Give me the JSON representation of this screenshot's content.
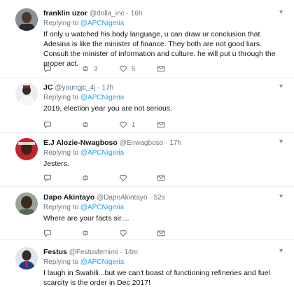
{
  "tweets": [
    {
      "name": "franklin uzor",
      "handle": "@dolla_inc",
      "time": "16h",
      "replying_label": "Replying to",
      "replying_to": "@APCNigeria",
      "text": "If only u watched his body language, u can draw ur conclusion that Adesina  is like the minister of finance.  They both are not good liars. Consult the minister of information and culture. he will put u through the proper act.",
      "reply_count": "",
      "retweet_count": "3",
      "like_count": "5"
    },
    {
      "name": "JC",
      "handle": "@youngjc_4j",
      "time": "17h",
      "replying_label": "Replying to",
      "replying_to": "@APCNigeria",
      "text": "2019, election year you are not serious.",
      "reply_count": "",
      "retweet_count": "",
      "like_count": "1"
    },
    {
      "name": "E.J Alozie-Nwagboso",
      "handle": "@Enwagboso",
      "time": "17h",
      "replying_label": "Replying to",
      "replying_to": "@APCNigeria",
      "text": "Jesters.",
      "reply_count": "",
      "retweet_count": "",
      "like_count": ""
    },
    {
      "name": "Dapo Akintayo",
      "handle": "@DapoAkintayo",
      "time": "52s",
      "replying_label": "Replying to",
      "replying_to": "@APCNigeria",
      "text": "Where are your facts sir....",
      "reply_count": "",
      "retweet_count": "",
      "like_count": ""
    },
    {
      "name": "Festus",
      "handle": "@Festusfemimi",
      "time": "14m",
      "replying_label": "Replying to",
      "replying_to": "@APCNigeria",
      "text": "I laugh in Swahili...but we can't boast of functioning refineries and fuel scarcity is the order in Dec 2017!",
      "reply_count": "",
      "retweet_count": "",
      "like_count": ""
    }
  ],
  "separator": "·",
  "icons": {
    "reply": "reply-icon",
    "retweet": "retweet-icon",
    "like": "heart-icon",
    "dm": "envelope-icon",
    "more": "chevron-down-icon"
  },
  "colors": {
    "link": "#1da1f2",
    "muted": "#657786",
    "divider": "#e6ecf0"
  }
}
